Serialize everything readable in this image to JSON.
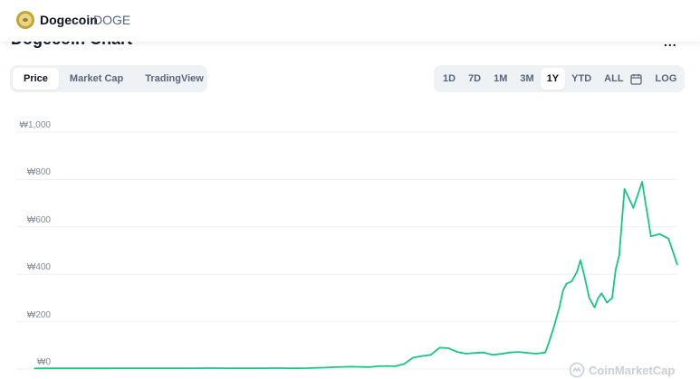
{
  "header": {
    "coin_name": "Dogecoin",
    "coin_symbol": "DOGE",
    "chart_title": "Dogecoin Chart",
    "more_label": "..."
  },
  "metric_tabs": [
    {
      "label": "Price",
      "active": true
    },
    {
      "label": "Market Cap",
      "active": false
    },
    {
      "label": "TradingView",
      "active": false
    }
  ],
  "range_tabs": [
    {
      "label": "1D",
      "active": false
    },
    {
      "label": "7D",
      "active": false
    },
    {
      "label": "1M",
      "active": false
    },
    {
      "label": "3M",
      "active": false
    },
    {
      "label": "1Y",
      "active": true
    },
    {
      "label": "YTD",
      "active": false
    },
    {
      "label": "ALL",
      "active": false
    }
  ],
  "log_label": "LOG",
  "watermark": "CoinMarketCap",
  "colors": {
    "line": "#16c784",
    "grid": "#eef0f3",
    "active_tab_bg": "#ffffff",
    "tab_group_bg": "#eff2f5"
  },
  "chart_data": {
    "type": "line",
    "title": "",
    "xlabel": "",
    "ylabel": "",
    "ylim": [
      0,
      1000
    ],
    "y_ticks": [
      {
        "value": 0,
        "label": "₩0"
      },
      {
        "value": 200,
        "label": "₩200"
      },
      {
        "value": 400,
        "label": "₩400"
      },
      {
        "value": 600,
        "label": "₩600"
      },
      {
        "value": 800,
        "label": "₩800"
      },
      {
        "value": 1000,
        "label": "₩1,000"
      }
    ],
    "grid": true,
    "series": [
      {
        "x": [
          0,
          10,
          20,
          30,
          40,
          50,
          60,
          70,
          80,
          90,
          100,
          110,
          120,
          125,
          130,
          135,
          140,
          145,
          150,
          155,
          160,
          165,
          170,
          175,
          180,
          185,
          190,
          195,
          200,
          205,
          210,
          215,
          220,
          225,
          230,
          235,
          240,
          245,
          250,
          255,
          260,
          265,
          270,
          275,
          280,
          285,
          290,
          292,
          295,
          298,
          300,
          302,
          305,
          308,
          310,
          312,
          315,
          318,
          320,
          322,
          325,
          328,
          330,
          332,
          335,
          340,
          345,
          350,
          355,
          360,
          365
        ],
        "values": [
          2.8,
          3,
          3.2,
          3.1,
          3,
          3.4,
          3.6,
          3.5,
          3.4,
          3.6,
          3.7,
          3.5,
          3.4,
          3.6,
          3.5,
          3.7,
          3.8,
          3.6,
          3.5,
          4,
          5.5,
          6,
          8,
          9,
          10,
          9,
          8,
          12,
          13,
          12,
          22,
          48,
          55,
          60,
          90,
          88,
          72,
          65,
          68,
          70,
          60,
          64,
          70,
          72,
          68,
          65,
          70,
          110,
          180,
          260,
          330,
          360,
          370,
          410,
          460,
          400,
          300,
          260,
          300,
          320,
          280,
          300,
          420,
          480,
          760,
          680,
          790,
          560,
          570,
          550,
          440
        ]
      }
    ]
  }
}
